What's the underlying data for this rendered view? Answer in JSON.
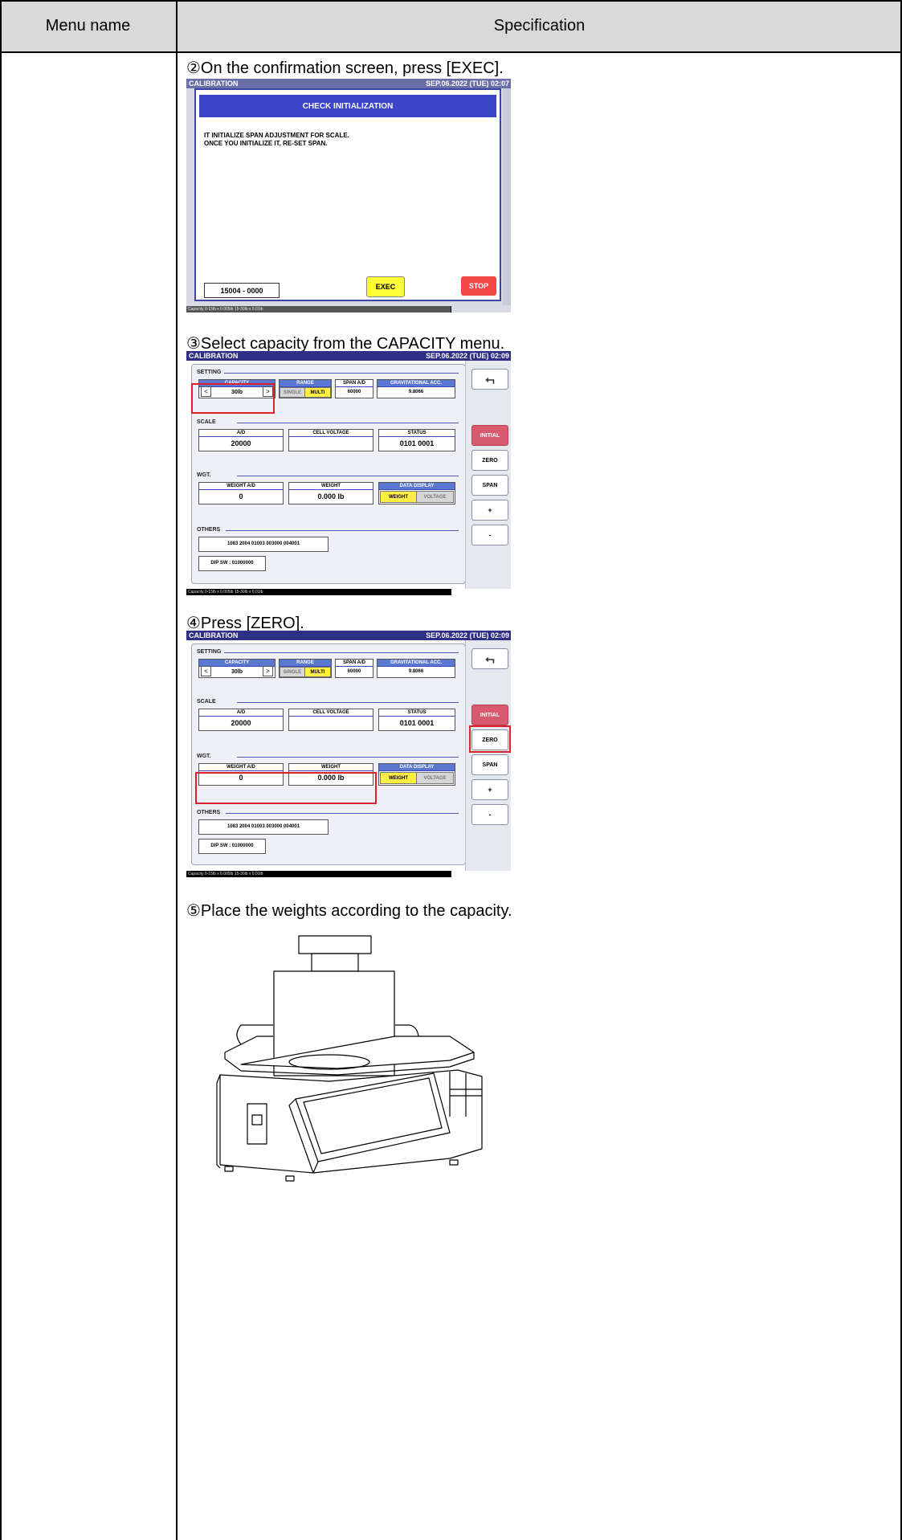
{
  "header": {
    "col1": "Menu name",
    "col2": "Specification"
  },
  "steps": {
    "s2": "②On the confirmation screen, press [EXEC].",
    "s3": "③Select capacity from the CAPACITY menu.",
    "s4": "④Press [ZERO].",
    "s5": "⑤Place the weights according to the capacity."
  },
  "screen1": {
    "title": "CALIBRATION",
    "datetime": "SEP.06.2022 (TUE)  02:07",
    "dialog_title": "CHECK INITIALIZATION",
    "message_line1": "IT INITIALIZE SPAN ADJUSTMENT FOR SCALE.",
    "message_line2": "ONCE YOU INITIALIZE IT, RE-SET SPAN.",
    "code": "15004 - 0000",
    "exec_label": "EXEC",
    "stop_label": "STOP",
    "footer": "Capacity 0-15lb x 0.005lb  15-30lb x 0.01lb"
  },
  "calib": {
    "title": "CALIBRATION",
    "datetime_s3": "SEP.06.2022 (TUE)  02:09",
    "datetime_s4": "SEP.06.2022 (TUE)  02:09",
    "setting": "SETTING",
    "capacity_label": "CAPACITY",
    "capacity_value": "30lb",
    "range_label": "RANGE",
    "single": "SINGLE",
    "multi": "MULTI",
    "span_ad_label": "SPAN A/D",
    "span_ad_value": "60000",
    "grav_label": "GRAVITATIONAL ACC.",
    "grav_value": "9.8066",
    "scale": "SCALE",
    "ad_label": "A/D",
    "ad_value": "20000",
    "cell_voltage_label": "CELL VOLTAGE",
    "cell_voltage_value": "",
    "status_label": "STATUS",
    "status_value": "0101 0001",
    "wgt": "WGT.",
    "weight_ad_label": "WEIGHT A/D",
    "weight_ad_value": "0",
    "weight_label": "WEIGHT",
    "weight_value": "0.000 lb",
    "data_display_label": "DATA DISPLAY",
    "weight_toggle": "WEIGHT",
    "voltage_toggle": "VOLTAGE",
    "others": "OTHERS",
    "others_code": "1083 2004 01003 003000 004001",
    "dip_sw": "DIP SW : 01000000",
    "btn_initial": "INITIAL",
    "btn_zero": "ZERO",
    "btn_span": "SPAN",
    "btn_plus": "+",
    "btn_minus": "-",
    "footer": "Capacity 0-15lb x 0.005lb  15-30lb x 0.01lb"
  }
}
